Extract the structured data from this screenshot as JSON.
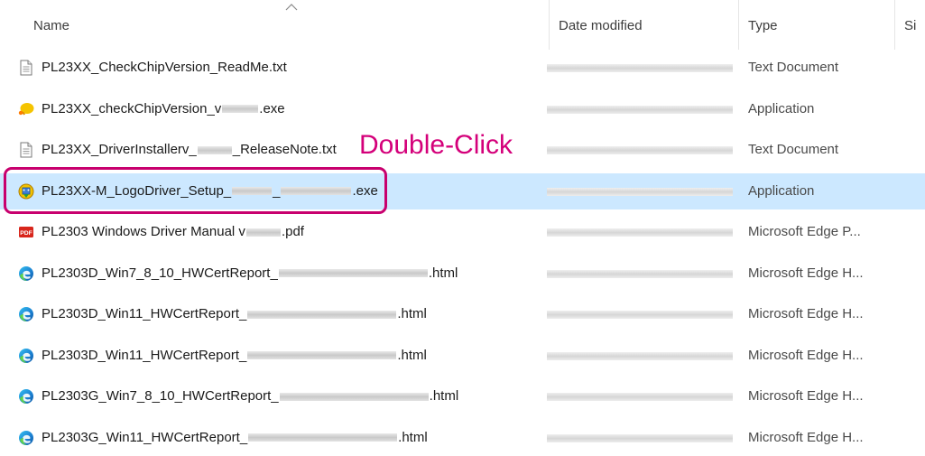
{
  "header": {
    "name": "Name",
    "date_modified": "Date modified",
    "type": "Type",
    "size": "Si"
  },
  "annotation": {
    "text": "Double-Click",
    "color": "#d4007a"
  },
  "colors": {
    "selection": "#cce8ff",
    "highlight_border": "#c8006e"
  },
  "files": [
    {
      "icon": "text-file-icon",
      "pre": "PL23XX_CheckChipVersion_ReadMe.txt",
      "mid": "",
      "post": "",
      "type": "Text Document",
      "selected": false
    },
    {
      "icon": "application-exe-icon",
      "pre": "PL23XX_checkChipVersion_v",
      "mid": "",
      "post": ".exe",
      "type": "Application",
      "selected": false
    },
    {
      "icon": "text-file-icon",
      "pre": "PL23XX_DriverInstallerv_",
      "mid": "",
      "post": "_ReleaseNote.txt",
      "type": "Text Document",
      "selected": false
    },
    {
      "icon": "setup-installer-icon",
      "pre": "PL23XX-M_LogoDriver_Setup_",
      "mid": "_",
      "post": ".exe",
      "type": "Application",
      "selected": true
    },
    {
      "icon": "pdf-file-icon",
      "pre": "PL2303 Windows Driver Manual v",
      "mid": "",
      "post": ".pdf",
      "type": "Microsoft Edge P...",
      "selected": false
    },
    {
      "icon": "edge-html-icon",
      "pre": "PL2303D_Win7_8_10_HWCertReport_",
      "mid": "",
      "post": ".html",
      "type": "Microsoft Edge H...",
      "selected": false
    },
    {
      "icon": "edge-html-icon",
      "pre": "PL2303D_Win11_HWCertReport_",
      "mid": "",
      "post": ".html",
      "type": "Microsoft Edge H...",
      "selected": false
    },
    {
      "icon": "edge-html-icon",
      "pre": "PL2303D_Win11_HWCertReport_",
      "mid": "",
      "post": ".html",
      "type": "Microsoft Edge H...",
      "selected": false
    },
    {
      "icon": "edge-html-icon",
      "pre": "PL2303G_Win7_8_10_HWCertReport_",
      "mid": "",
      "post": ".html",
      "type": "Microsoft Edge H...",
      "selected": false
    },
    {
      "icon": "edge-html-icon",
      "pre": "PL2303G_Win11_HWCertReport_",
      "mid": "",
      "post": ".html",
      "type": "Microsoft Edge H...",
      "selected": false
    }
  ]
}
